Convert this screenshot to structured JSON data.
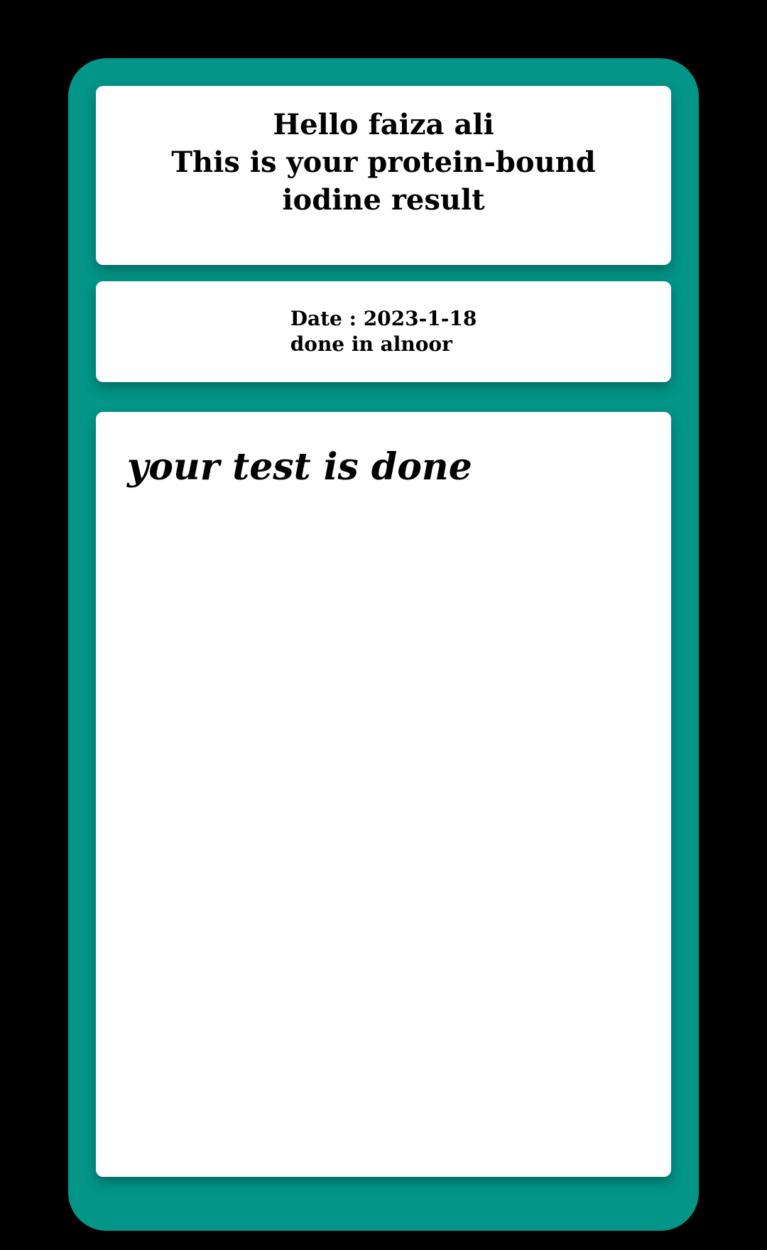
{
  "colors": {
    "background": "#000000",
    "frame": "#029588",
    "card": "#ffffff",
    "text": "#000000"
  },
  "header": {
    "greeting": "Hello faiza ali",
    "line2": "This is your protein-bound",
    "line3": "iodine  result"
  },
  "info": {
    "date": "Date : 2023-1-18",
    "location": "done in alnoor"
  },
  "result": {
    "message": "your test is done"
  }
}
